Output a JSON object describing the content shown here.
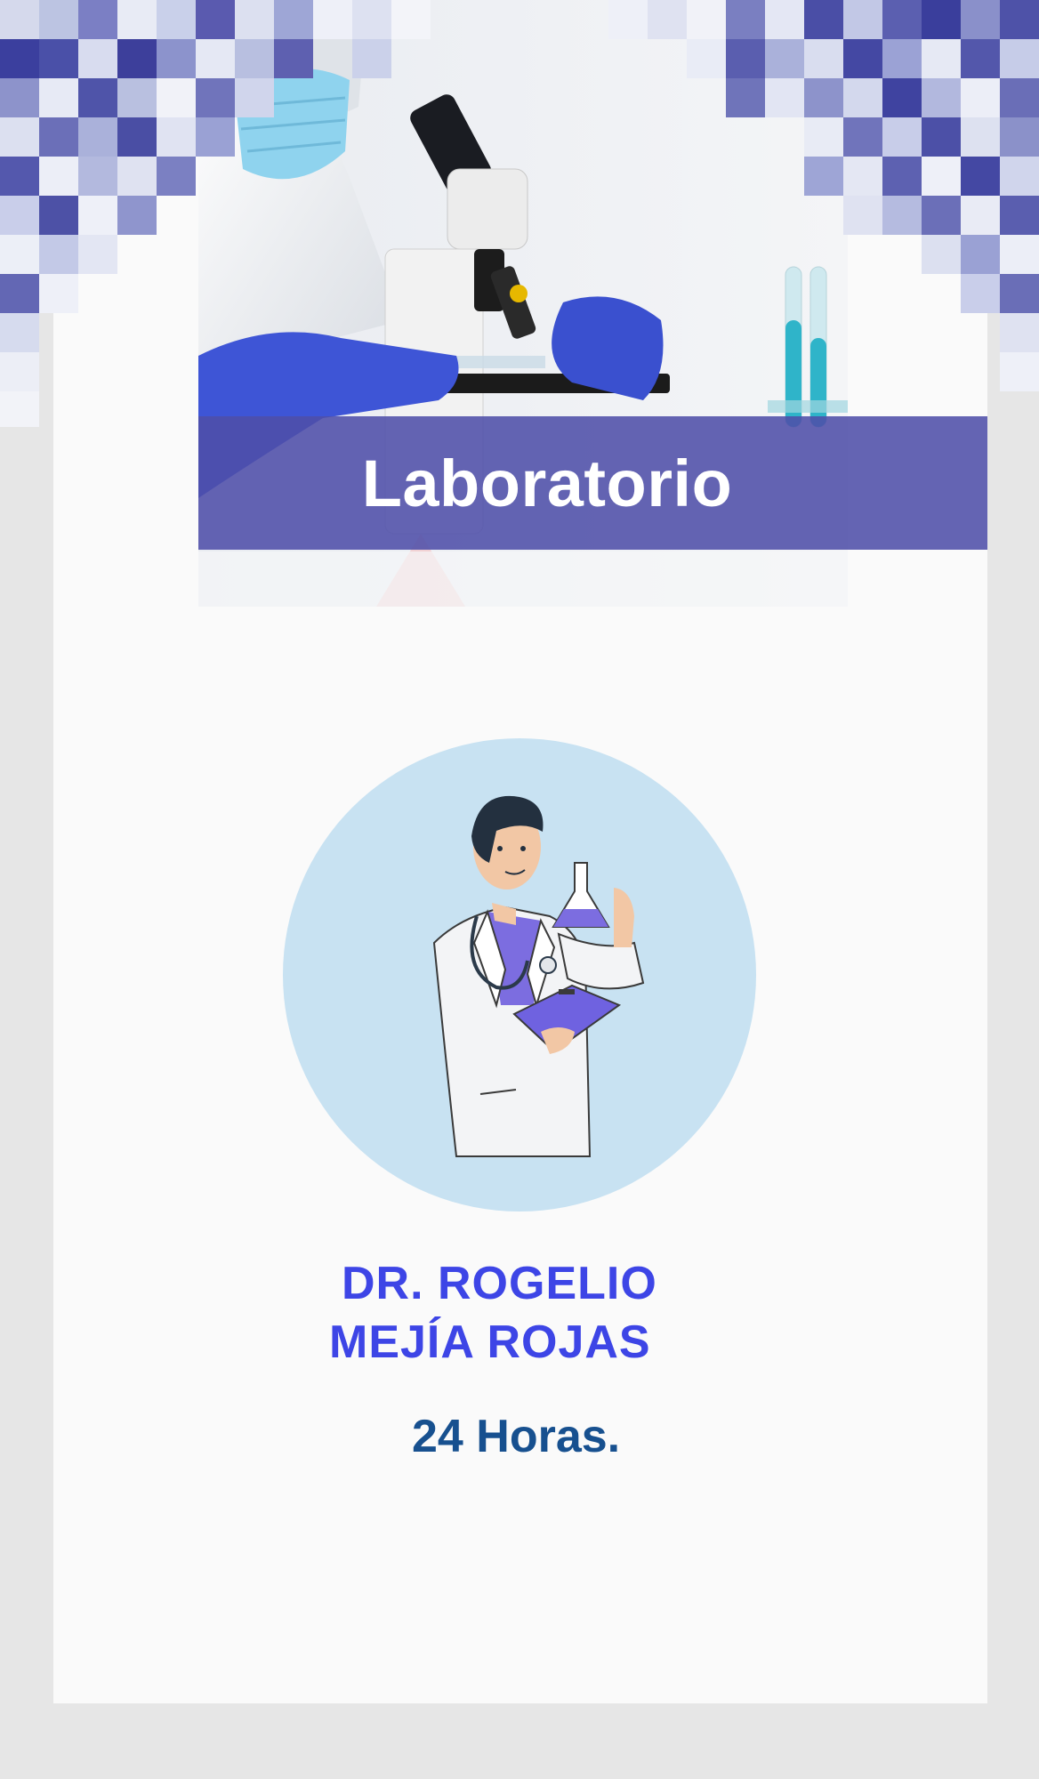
{
  "header": {
    "title": "Laboratorio",
    "banner_color": "#4e4ea8"
  },
  "doctor": {
    "name_line1": "DR. ROGELIO",
    "name_line2": "MEJÍA ROJAS",
    "name_color": "#3d45e6"
  },
  "schedule": {
    "hours": "24 Horas.",
    "color": "#17508f"
  },
  "icons": [
    "microscope-photo",
    "doctor-illustration-icon",
    "flask-icon",
    "clipboard-icon",
    "stethoscope-icon"
  ]
}
